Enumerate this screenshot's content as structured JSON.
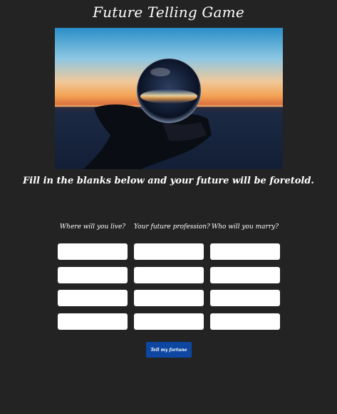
{
  "header": {
    "title": "Future Telling Game"
  },
  "hero": {
    "image": "crystal-ball-sunset-photo"
  },
  "instructions": "Fill in the blanks below and your future will be foretold.",
  "form": {
    "columns": [
      {
        "label": "Where will you live?",
        "fields": [
          "",
          "",
          "",
          ""
        ]
      },
      {
        "label": "Your future profession?",
        "fields": [
          "",
          "",
          "",
          ""
        ]
      },
      {
        "label": "Who will you marry?",
        "fields": [
          "",
          "",
          "",
          ""
        ]
      }
    ],
    "submit_label": "Tell my fortune"
  },
  "colors": {
    "background": "#232323",
    "button": "#0d47a1",
    "text": "#ffffff",
    "field": "#ffffff"
  }
}
